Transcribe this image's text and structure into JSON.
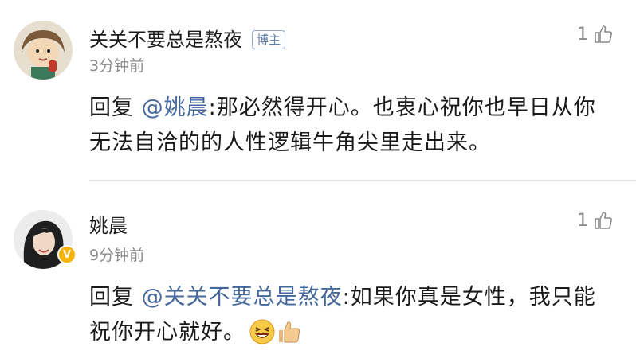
{
  "comments": [
    {
      "author": "关关不要总是熬夜",
      "badge": "博主",
      "time": "3分钟前",
      "likes": "1",
      "reply_prefix": "回复 ",
      "mention": "@姚晨",
      "text": ":那必然得开心。也衷心祝你也早日从你无法自洽的的人性逻辑牛角尖里走出来。"
    },
    {
      "author": "姚晨",
      "time": "9分钟前",
      "likes": "1",
      "verified_mark": "V",
      "reply_prefix": "回复 ",
      "mention": "@关关不要总是熬夜",
      "text": ":如果你真是女性，我只能祝你开心就好。",
      "emojis": [
        "laughing-emoji",
        "thumbs-up-emoji"
      ]
    }
  ],
  "colors": {
    "mention": "#44679c",
    "badge": "#5d7ea8",
    "verified": "#f5b400",
    "muted": "#8a8a8a"
  }
}
